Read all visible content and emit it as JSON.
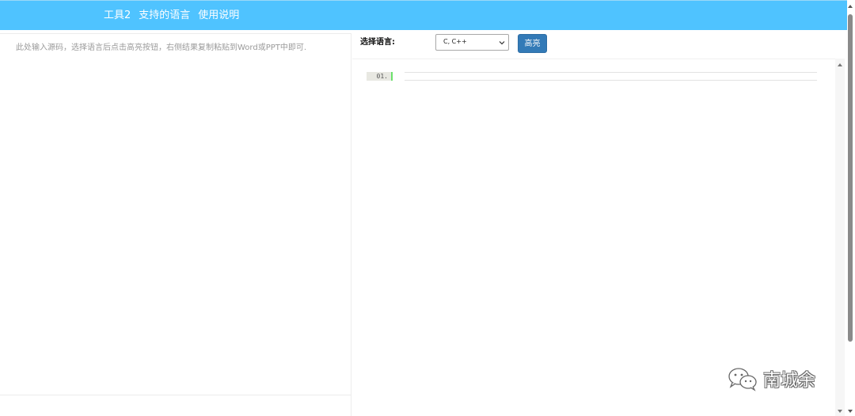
{
  "nav": {
    "items": [
      {
        "label": "工具2"
      },
      {
        "label": "支持的语言"
      },
      {
        "label": "使用说明"
      }
    ]
  },
  "editor": {
    "placeholder": "此处输入源码，选择语言后点击高亮按钮，右侧结果复制粘贴到Word或PPT中即可."
  },
  "controls": {
    "language_label": "选择语言:",
    "language_selected": "C, C++",
    "highlight_button": "高亮"
  },
  "output": {
    "lines": [
      {
        "number": "01.",
        "code": ""
      }
    ]
  },
  "watermark": {
    "text": "南城余",
    "icon": "wechat-icon"
  },
  "colors": {
    "topbar": "#4fc3ff",
    "button": "#337ab7",
    "gutter_marker": "#6ce26c"
  }
}
